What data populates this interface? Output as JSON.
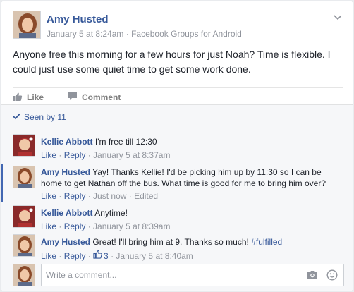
{
  "post": {
    "author": "Amy Husted",
    "date": "January 5 at 8:24am",
    "dot": " · ",
    "source": "Facebook Groups for Android",
    "text": "Anyone free this morning for a few hours for just Noah? Time is flexible. I could just use some quiet time to get some work done."
  },
  "actions": {
    "like_label": "Like",
    "comment_label": "Comment"
  },
  "seen": {
    "label": "Seen by 11"
  },
  "comments": [
    {
      "author": "Kellie Abbott",
      "text": "I'm free till 12:30",
      "like": "Like",
      "reply": "Reply",
      "time": "January 5 at 8:37am"
    },
    {
      "author": "Amy Husted",
      "text": "Yay! Thanks Kellie! I'd be picking him up by 11:30 so I can be home to get Nathan off the bus. What time is good for me to bring him over?",
      "like": "Like",
      "reply": "Reply",
      "time": "Just now",
      "edited": "Edited"
    },
    {
      "author": "Kellie Abbott",
      "text": "Anytime!",
      "like": "Like",
      "reply": "Reply",
      "time": "January 5 at 8:39am"
    },
    {
      "author": "Amy Husted",
      "text": "Great! I'll bring him at 9. Thanks so much! ",
      "hashtag": "#fulfilled",
      "like": "Like",
      "reply": "Reply",
      "like_count": "3",
      "time": "January 5 at 8:40am"
    }
  ],
  "composer": {
    "placeholder": "Write a comment..."
  },
  "colors": {
    "link": "#365899",
    "meta": "#90949c",
    "accent": "#4267b2",
    "feedback_bg": "#f6f7f9"
  },
  "icons": [
    "chevron-down-icon",
    "thumbs-up-icon",
    "comment-icon",
    "checkmark-icon",
    "camera-icon",
    "smiley-icon"
  ]
}
